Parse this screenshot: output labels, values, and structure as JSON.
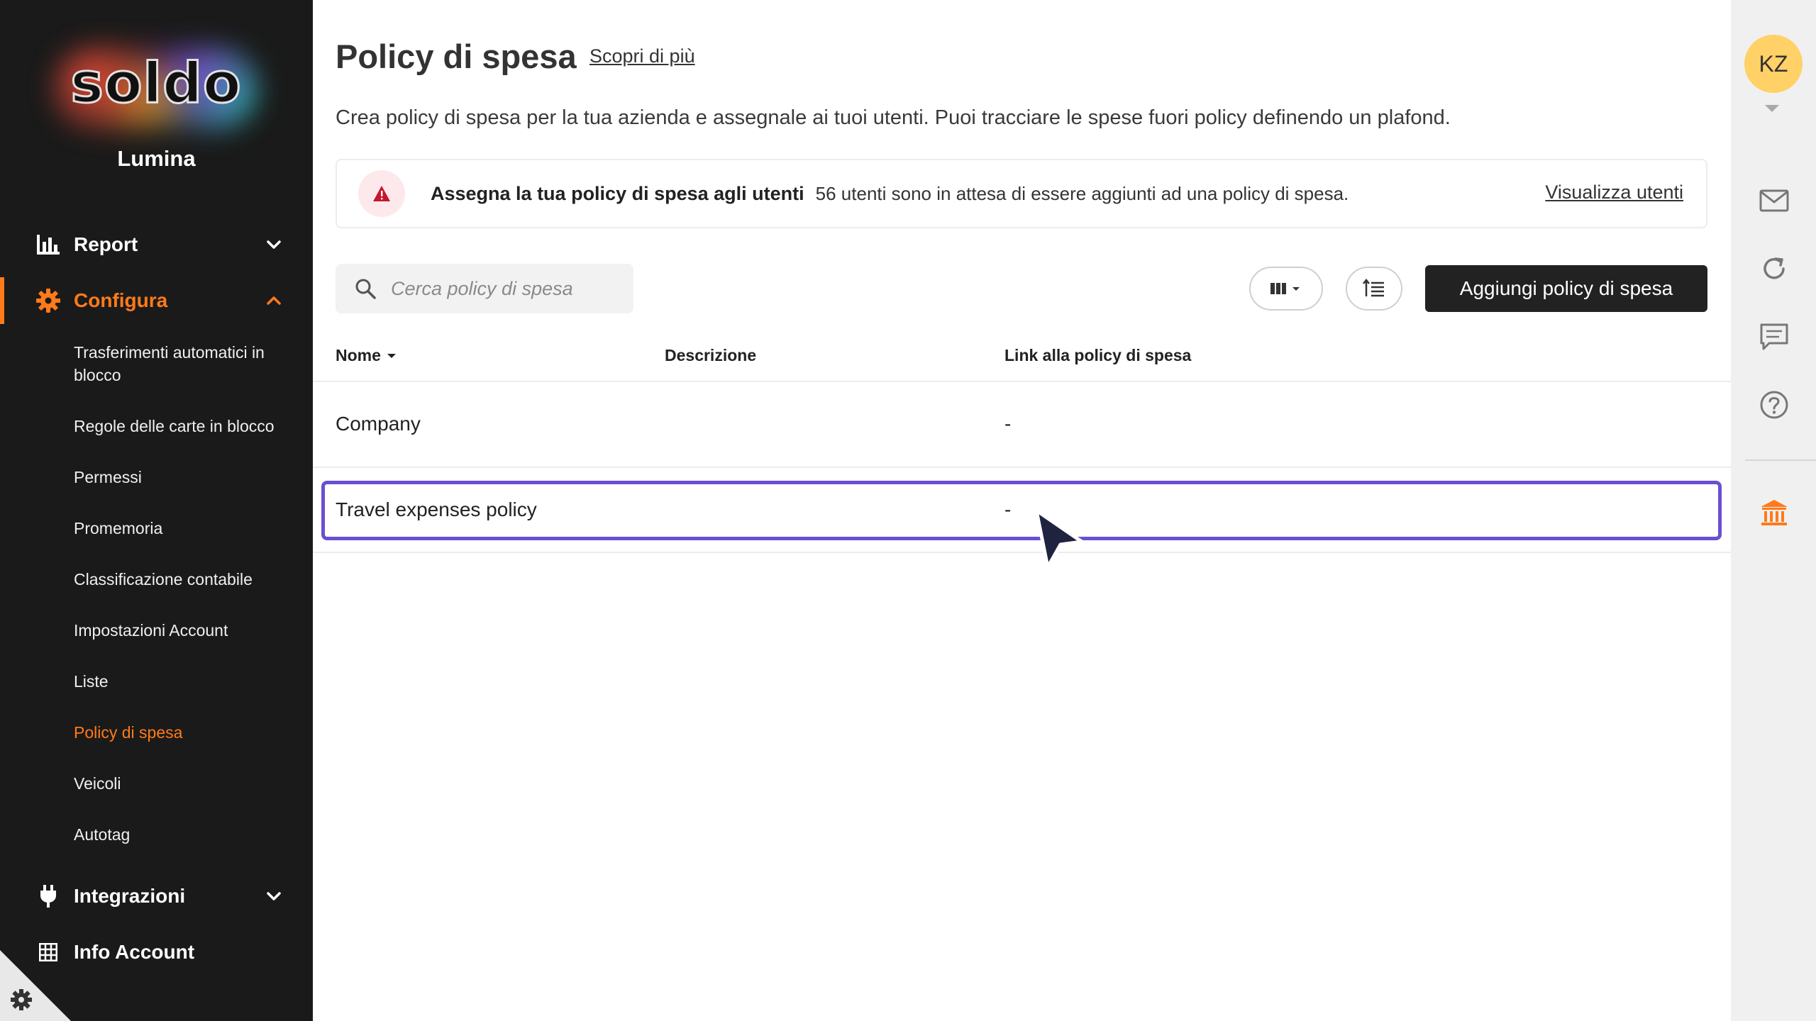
{
  "sidebar": {
    "logo_text": "soldo",
    "company_name": "Lumina",
    "nav": {
      "report": "Report",
      "configura": "Configura",
      "integrazioni": "Integrazioni",
      "info_account": "Info Account"
    },
    "sub_items": [
      "Trasferimenti automatici in blocco",
      "Regole delle carte in blocco",
      "Permessi",
      "Promemoria",
      "Classificazione contabile",
      "Impostazioni Account",
      "Liste",
      "Policy di spesa",
      "Veicoli",
      "Autotag"
    ],
    "active_sub_item": "Policy di spesa",
    "accent_color": "#ff7a1a"
  },
  "header": {
    "title": "Policy di spesa",
    "learn_more": "Scopri di più",
    "subtitle": "Crea policy di spesa per la tua azienda e assegnale ai tuoi utenti. Puoi tracciare le spese fuori policy definendo un plafond."
  },
  "banner": {
    "icon": "warning-icon",
    "title": "Assegna la tua policy di spesa agli utenti",
    "text": "56 utenti sono in attesa di essere aggiunti ad una policy di spesa.",
    "link": "Visualizza utenti"
  },
  "toolbar": {
    "search_placeholder": "Cerca policy di spesa",
    "add_button": "Aggiungi policy di spesa",
    "columns_icon": "columns-icon",
    "sort_icon": "sort-list-icon"
  },
  "table": {
    "columns": [
      "Nome",
      "Descrizione",
      "Link alla policy di spesa"
    ],
    "rows": [
      {
        "name": "Company",
        "description": "",
        "link": "-"
      },
      {
        "name": "Travel expenses policy",
        "description": "",
        "link": "-"
      }
    ],
    "highlight_color": "#6a4fd3"
  },
  "rail": {
    "avatar_initials": "KZ",
    "avatar_color": "#ffd166",
    "icons": [
      "mail-icon",
      "refresh-icon",
      "chat-icon",
      "help-icon",
      "bank-icon"
    ]
  }
}
